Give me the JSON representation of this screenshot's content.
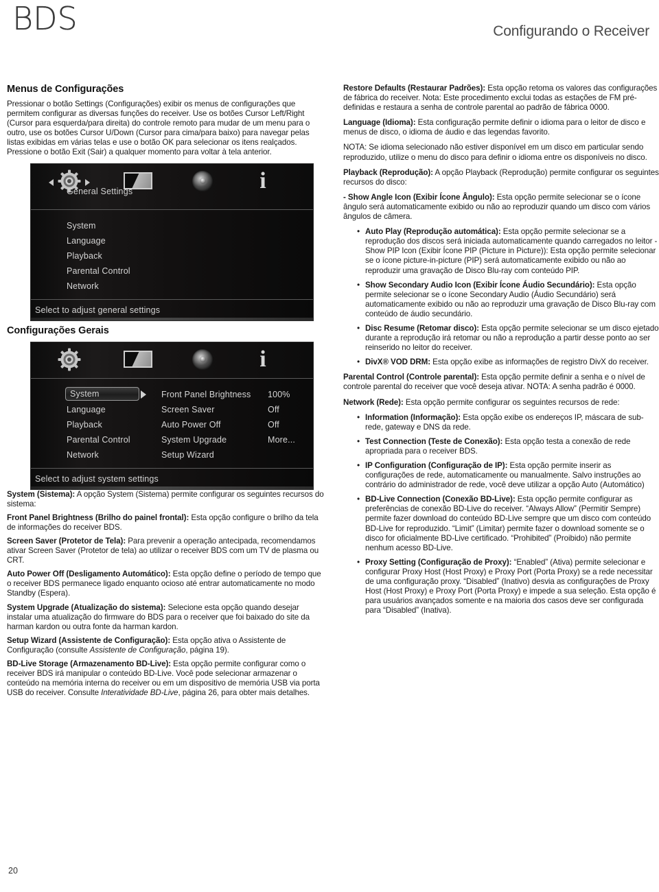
{
  "header": {
    "logo": "BDS",
    "title": "Configurando o Receiver"
  },
  "page_number": "20",
  "left_column": {
    "section_title": "Menus de Configurações",
    "intro": "Pressionar o botão Settings (Configurações) exibir os menus de configurações que permitem configurar as diversas funções do receiver. Use os botões Cursor Left/Right (Cursor para esquerda/para direita) do controle remoto para mudar de um menu para o outro, use os botões Cursor U/Down (Cursor para cima/para baixo) para navegar pelas listas exibidas em várias telas e use o botão OK para selecionar os itens realçados. Pressione o botão Exit (Sair) a qualquer momento para voltar à tela anterior.",
    "caption_general": "Configurações Gerais",
    "paragraphs": [
      {
        "bold": "System (Sistema):",
        "text": " A opção System (Sistema) permite configurar os seguintes recursos do sistema:"
      },
      {
        "bold": "Front Panel Brightness (Brilho do painel frontal):",
        "text": " Esta opção configure o brilho da tela de informações do receiver BDS."
      },
      {
        "bold": "Screen Saver (Protetor de Tela):",
        "text": " Para prevenir a operação antecipada, recomendamos ativar Screen Saver (Protetor de tela) ao utilizar o receiver BDS com um TV de plasma ou CRT."
      },
      {
        "bold": "Auto Power Off (Desligamento Automático):",
        "text": " Esta opção define o período de tempo que o receiver BDS permanece ligado enquanto ocioso até entrar automaticamente no modo Standby (Espera)."
      },
      {
        "bold": "System Upgrade (Atualização do sistema):",
        "text": " Selecione esta opção quando desejar instalar uma atualização do firmware do BDS para o receiver que foi baixado do site da harman kardon ou outra fonte da harman kardon."
      }
    ],
    "setup_wizard": {
      "bold": "Setup Wizard (Assistente de Configuração):",
      "text_a": " Esta opção ativa o Assistente de Configuração (consulte ",
      "italic": "Assistente de Configuração",
      "text_b": ", página 19)."
    },
    "bd_live_storage": {
      "bold": "BD-Live Storage (Armazenamento BD-Live):",
      "text_a": " Esta opção permite configurar como o receiver BDS irá manipular o conteúdo BD-Live. Você pode selecionar armazenar o conteúdo na memória interna do receiver ou em um dispositivo de memória USB via porta USB do receiver.  Consulte ",
      "italic": "Interatividade BD-Live",
      "text_b": ", página 26, para obter mais detalhes."
    }
  },
  "osd_general": {
    "icons": [
      "gear-icon",
      "display-icon",
      "speaker-icon",
      "info-icon"
    ],
    "tab_label": "General Settings",
    "items": [
      "System",
      "Language",
      "Playback",
      "Parental Control",
      "Network"
    ],
    "footer": "Select to adjust general settings"
  },
  "osd_system": {
    "icons": [
      "gear-icon",
      "display-icon",
      "speaker-icon",
      "info-icon"
    ],
    "menu_items": [
      "System",
      "Language",
      "Playback",
      "Parental Control",
      "Network"
    ],
    "selected_item": "System",
    "settings": [
      {
        "label": "Front Panel Brightness",
        "value": "100%"
      },
      {
        "label": "Screen Saver",
        "value": "Off"
      },
      {
        "label": "Auto Power Off",
        "value": "Off"
      },
      {
        "label": "System Upgrade",
        "value": "More..."
      },
      {
        "label": "Setup Wizard",
        "value": ""
      }
    ],
    "footer": "Select to adjust system settings"
  },
  "right_column": {
    "restore_defaults": {
      "bold": "Restore Defaults (Restaurar Padrões):",
      "text": " Esta opção retoma os valores das configurações de fábrica do receiver. Nota: Este procedimento exclui todas as estações de FM pré-definidas e restaura a senha de controle parental ao padrão de fábrica 0000."
    },
    "language": {
      "bold": "Language (Idioma):",
      "text": " Esta configuração permite definir o idioma para o leitor de disco e menus de disco, o idioma de áudio e das legendas favorito."
    },
    "note_language": "NOTA: Se idioma selecionado não estiver disponível em um disco em particular sendo reproduzido, utilize o menu do disco para definir o idioma entre os disponíveis no disco.",
    "playback": {
      "bold": "Playback (Reprodução):",
      "text": " A opção Playback (Reprodução) permite configurar os seguintes recursos do disco:"
    },
    "show_angle_icon": {
      "bold": "- Show Angle Icon (Exibir Ícone Ângulo):",
      "text": " Esta opção permite selecionar se o ícone ângulo será automaticamente exibido ou não ao reproduzir quando um disco com vários ângulos de câmera."
    },
    "playback_bullets": [
      {
        "bold": "Auto Play (Reprodução automática):",
        "text": " Esta opção permite selecionar se a reprodução dos discos será iniciada automaticamente quando carregados no leitor - Show PIP Icon (Exibir Ícone PIP (Picture in Picture)): Esta opção permite selecionar se o ícone picture-in-picture (PIP) será automaticamente exibido ou não ao reproduzir uma gravação de Disco Blu-ray com conteúdo PIP."
      },
      {
        "bold": "Show Secondary Audio Icon (Exibir Ícone Áudio Secundário):",
        "text": " Esta opção permite selecionar se o ícone Secondary Audio (Áudio Secundário) será automaticamente exibido ou não ao reproduzir uma gravação de Disco Blu-ray com conteúdo de áudio secundário."
      },
      {
        "bold": "Disc Resume (Retomar disco):",
        "text": " Esta opção permite selecionar se um disco ejetado durante a reprodução irá retomar ou não a reprodução a partir desse ponto ao ser reinserido no leitor do receiver."
      },
      {
        "bold": "DivX® VOD DRM:",
        "text": " Esta opção exibe as informações de registro DivX do receiver."
      }
    ],
    "parental_control": {
      "bold": "Parental Control (Controle parental):",
      "text": " Esta opção permite definir a senha e o nível de controle parental do receiver que você deseja ativar.  NOTA: A senha padrão é 0000."
    },
    "network": {
      "bold": "Network (Rede):",
      "text": " Esta opção permite configurar os seguintes recursos de rede:"
    },
    "network_bullets": [
      {
        "bold": "Information (Informação):",
        "text": " Esta opção exibe os endereços IP, máscara de sub-rede, gateway e DNS da rede."
      },
      {
        "bold": "Test Connection (Teste de Conexão):",
        "text": " Esta opção testa a conexão de rede apropriada para o receiver BDS."
      },
      {
        "bold": "IP Configuration (Configuração de IP):",
        "text": " Esta opção permite inserir as configurações de rede, automaticamente ou manualmente. Salvo instruções ao contrário do administrador de rede, você deve utilizar a opção Auto (Automático)"
      },
      {
        "bold": "BD-Live Connection (Conexão BD-Live):",
        "text": " Esta opção permite configurar as preferências de conexão BD-Live do receiver. “Always Allow” (Permitir Sempre) permite fazer download do conteúdo BD-Live sempre que um disco com conteúdo BD-Live for reproduzido. “Limit” (Limitar) permite fazer o download somente se o disco for oficialmente BD-Live certificado. “Prohibited” (Proibido) não permite nenhum acesso BD-Live."
      },
      {
        "bold": "Proxy Setting (Configuração de Proxy):",
        "text": " “Enabled” (Ativa) permite selecionar e configurar Proxy Host (Host Proxy) e Proxy Port (Porta Proxy) se a rede necessitar de uma configuração proxy. “Disabled” (Inativo) desvia as configurações de  Proxy Host (Host Proxy) e Proxy Port (Porta Proxy) e impede a sua seleção. Esta opção é para usuários avançados somente e na maioria dos casos deve ser configurada para “Disabled” (Inativa)."
      }
    ]
  }
}
